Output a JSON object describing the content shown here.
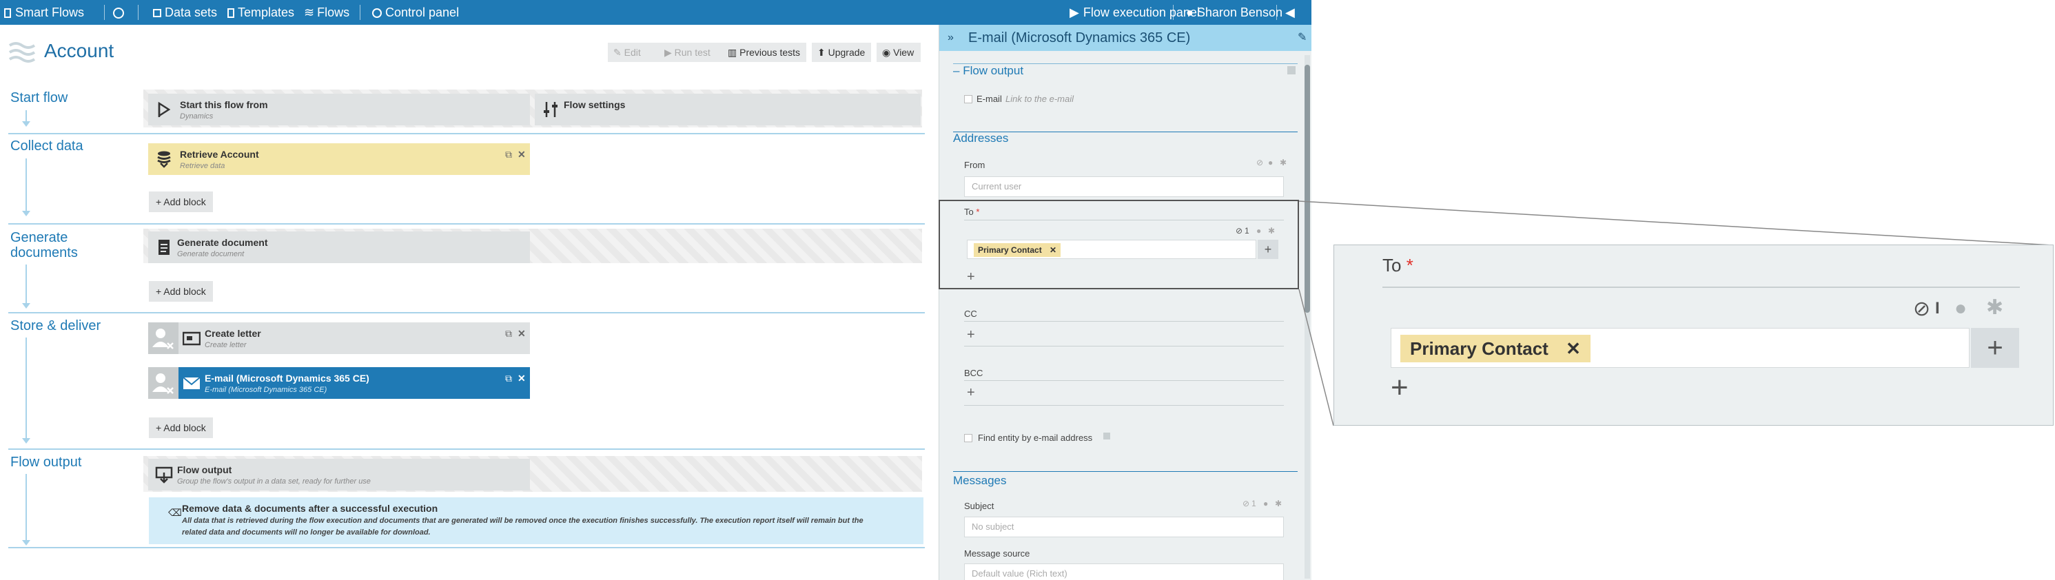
{
  "topbar": {
    "brand": "Smart Flows",
    "nav": [
      "Data sets",
      "Templates",
      "Flows",
      "Control panel"
    ],
    "flow_execution_panel": "Flow execution panel",
    "user": "Sharon Benson"
  },
  "page": {
    "title": "Account"
  },
  "toolbar": {
    "edit": "Edit",
    "run_test": "Run test",
    "previous_tests": "Previous tests",
    "upgrade": "Upgrade",
    "view": "View"
  },
  "sections": {
    "start_flow": "Start flow",
    "collect_data": "Collect data",
    "generate_documents_1": "Generate",
    "generate_documents_2": "documents",
    "store_deliver": "Store & deliver",
    "flow_output": "Flow output"
  },
  "blocks": {
    "start": {
      "title": "Start this flow from",
      "sub": "Dynamics"
    },
    "settings": {
      "title": "Flow settings"
    },
    "retrieve": {
      "title": "Retrieve Account",
      "sub": "Retrieve data"
    },
    "generate": {
      "title": "Generate document",
      "sub": "Generate document"
    },
    "letter": {
      "title": "Create letter",
      "sub": "Create letter"
    },
    "email": {
      "title": "E-mail (Microsoft Dynamics 365 CE)",
      "sub": "E-mail (Microsoft Dynamics 365 CE)"
    },
    "output": {
      "title": "Flow output",
      "sub": "Group the flow's output in a data set, ready for further use"
    },
    "remove": {
      "title": "Remove data & documents after a successful execution",
      "text1": "All data that is retrieved during the flow execution and documents that are generated will be removed once the execution finishes successfully. The execution report itself will remain but the",
      "text2": "related data and documents will no longer be available for download."
    }
  },
  "add_block": "Add block",
  "panel": {
    "title": "E-mail (Microsoft Dynamics 365 CE)",
    "flow_output_section": "Flow output",
    "email_checkbox": "E-mail",
    "email_link": "Link to the e-mail",
    "addresses": "Addresses",
    "from": "From",
    "from_placeholder": "Current user",
    "to": "To",
    "to_chip": "Primary Contact",
    "cc": "CC",
    "bcc": "BCC",
    "find_entity": "Find entity by e-mail address",
    "messages": "Messages",
    "subject": "Subject",
    "subject_placeholder": "No subject",
    "message_source": "Message source",
    "message_source_value": "Default value (Rich text)",
    "count_to": "1",
    "count_subject": "1"
  },
  "zoom": {
    "to": "To",
    "chip": "Primary Contact",
    "count": "I"
  },
  "colors": {
    "topbar": "#1f7ab5",
    "panel_header": "#9fd6ef",
    "selected_block": "#1f7ab5",
    "retrieve_block": "#f3e6a8",
    "info_box": "#d4edf9",
    "chip": "#f3e1a4",
    "required": "#e0312a"
  }
}
